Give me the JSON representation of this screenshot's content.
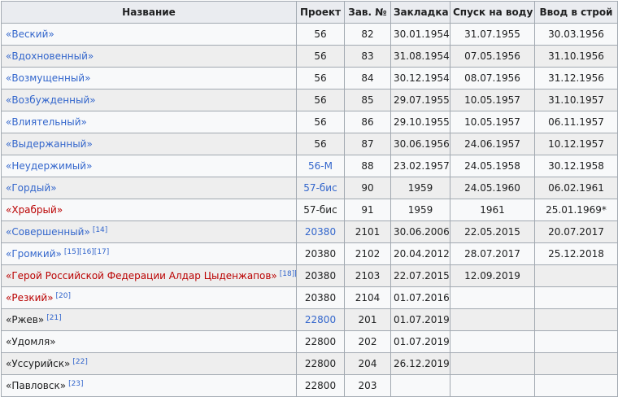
{
  "table": {
    "headers": [
      "Название",
      "Проект",
      "Зав. №",
      "Закладка",
      "Спуск на воду",
      "Ввод в строй"
    ],
    "rows": [
      {
        "name": "«Веский»",
        "name_link": "blue",
        "refs": "",
        "project": "56",
        "project_link": false,
        "serial": "82",
        "laid": "30.01.1954",
        "launched": "31.07.1955",
        "commissioned": "30.03.1956"
      },
      {
        "name": "«Вдохновенный»",
        "name_link": "blue",
        "refs": "",
        "project": "56",
        "project_link": false,
        "serial": "83",
        "laid": "31.08.1954",
        "launched": "07.05.1956",
        "commissioned": "31.10.1956"
      },
      {
        "name": "«Возмущенный»",
        "name_link": "blue",
        "refs": "",
        "project": "56",
        "project_link": false,
        "serial": "84",
        "laid": "30.12.1954",
        "launched": "08.07.1956",
        "commissioned": "31.12.1956"
      },
      {
        "name": "«Возбужденный»",
        "name_link": "blue",
        "refs": "",
        "project": "56",
        "project_link": false,
        "serial": "85",
        "laid": "29.07.1955",
        "launched": "10.05.1957",
        "commissioned": "31.10.1957"
      },
      {
        "name": "«Влиятельный»",
        "name_link": "blue",
        "refs": "",
        "project": "56",
        "project_link": false,
        "serial": "86",
        "laid": "29.10.1955",
        "launched": "10.05.1957",
        "commissioned": "06.11.1957"
      },
      {
        "name": "«Выдержанный»",
        "name_link": "blue",
        "refs": "",
        "project": "56",
        "project_link": false,
        "serial": "87",
        "laid": "30.06.1956",
        "launched": "24.06.1957",
        "commissioned": "10.12.1957"
      },
      {
        "name": "«Неудержимый»",
        "name_link": "blue",
        "refs": "",
        "project": "56-М",
        "project_link": true,
        "serial": "88",
        "laid": "23.02.1957",
        "launched": "24.05.1958",
        "commissioned": "30.12.1958"
      },
      {
        "name": "«Гордый»",
        "name_link": "blue",
        "refs": "",
        "project": "57-бис",
        "project_link": true,
        "serial": "90",
        "laid": "1959",
        "launched": "24.05.1960",
        "commissioned": "06.02.1961"
      },
      {
        "name": "«Храбрый»",
        "name_link": "red",
        "refs": "",
        "project": "57-бис",
        "project_link": false,
        "serial": "91",
        "laid": "1959",
        "launched": "1961",
        "commissioned": "25.01.1969*"
      },
      {
        "name": "«Совершенный»",
        "name_link": "blue",
        "refs": "[14]",
        "project": "20380",
        "project_link": true,
        "serial": "2101",
        "laid": "30.06.2006",
        "launched": "22.05.2015",
        "commissioned": "20.07.2017"
      },
      {
        "name": "«Громкий»",
        "name_link": "blue",
        "refs": "[15][16][17]",
        "project": "20380",
        "project_link": false,
        "serial": "2102",
        "laid": "20.04.2012",
        "launched": "28.07.2017",
        "commissioned": "25.12.2018"
      },
      {
        "name": "«Герой Российской Федерации Алдар Цыденжапов»",
        "name_link": "red",
        "refs": "[18][19]",
        "project": "20380",
        "project_link": false,
        "serial": "2103",
        "laid": "22.07.2015",
        "launched": "12.09.2019",
        "commissioned": ""
      },
      {
        "name": "«Резкий»",
        "name_link": "red",
        "refs": "[20]",
        "project": "20380",
        "project_link": false,
        "serial": "2104",
        "laid": "01.07.2016",
        "launched": "",
        "commissioned": ""
      },
      {
        "name": "«Ржев»",
        "name_link": "none",
        "refs": "[21]",
        "project": "22800",
        "project_link": true,
        "serial": "201",
        "laid": "01.07.2019",
        "launched": "",
        "commissioned": ""
      },
      {
        "name": "«Удомля»",
        "name_link": "none",
        "refs": "",
        "project": "22800",
        "project_link": false,
        "serial": "202",
        "laid": "01.07.2019",
        "launched": "",
        "commissioned": ""
      },
      {
        "name": "«Уссурийск»",
        "name_link": "none",
        "refs": "[22]",
        "project": "22800",
        "project_link": false,
        "serial": "204",
        "laid": "26.12.2019",
        "launched": "",
        "commissioned": ""
      },
      {
        "name": "«Павловск»",
        "name_link": "none",
        "refs": "[23]",
        "project": "22800",
        "project_link": false,
        "serial": "203",
        "laid": "",
        "launched": "",
        "commissioned": ""
      }
    ]
  },
  "colors": {
    "link": "#3366cc",
    "redlink": "#ba0000",
    "header_bg": "#eaecf0",
    "border": "#a2a9b1",
    "row_bg": "#f8f9fa",
    "row_alt_bg": "#eeeeee",
    "text": "#202122"
  }
}
